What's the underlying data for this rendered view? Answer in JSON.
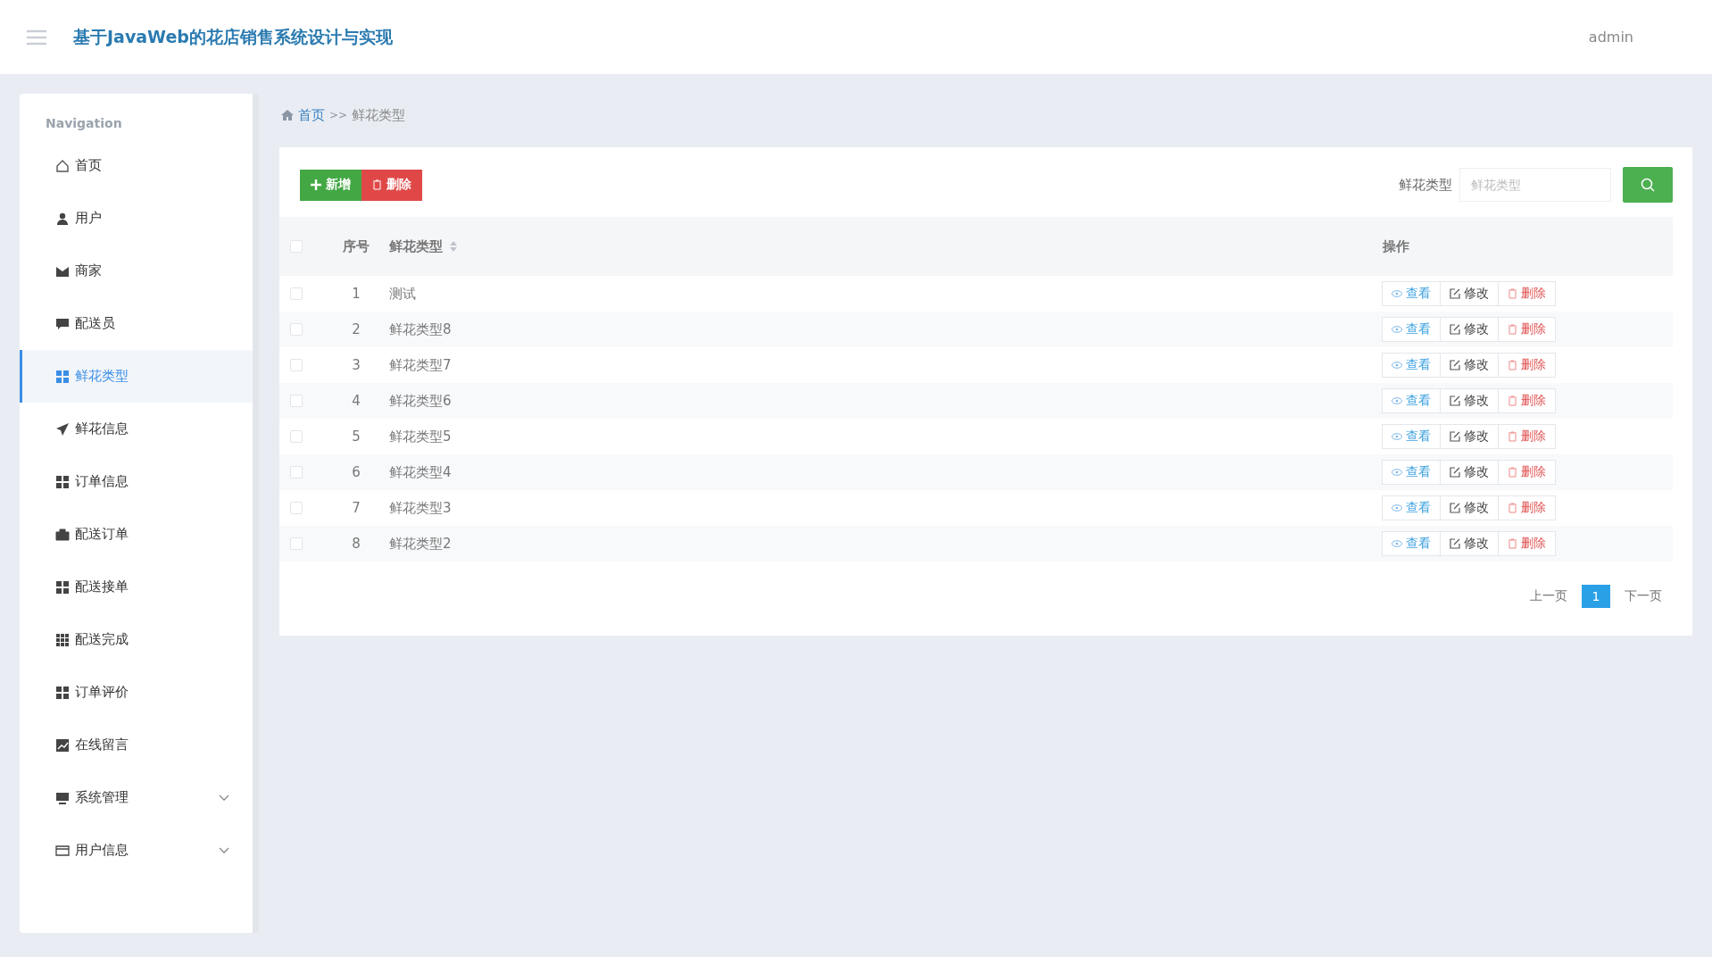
{
  "header": {
    "title": "基于JavaWeb的花店销售系统设计与实现",
    "user": "admin"
  },
  "sidebar": {
    "heading": "Navigation",
    "items": [
      {
        "label": "首页",
        "kind": "link",
        "selected": false
      },
      {
        "label": "用户",
        "kind": "link",
        "selected": false
      },
      {
        "label": "商家",
        "kind": "link",
        "selected": false
      },
      {
        "label": "配送员",
        "kind": "link",
        "selected": false
      },
      {
        "label": "鲜花类型",
        "kind": "link",
        "selected": true
      },
      {
        "label": "鲜花信息",
        "kind": "link",
        "selected": false
      },
      {
        "label": "订单信息",
        "kind": "link",
        "selected": false
      },
      {
        "label": "配送订单",
        "kind": "link",
        "selected": false
      },
      {
        "label": "配送接单",
        "kind": "link",
        "selected": false
      },
      {
        "label": "配送完成",
        "kind": "link",
        "selected": false
      },
      {
        "label": "订单评价",
        "kind": "link",
        "selected": false
      },
      {
        "label": "在线留言",
        "kind": "link",
        "selected": false
      },
      {
        "label": "系统管理",
        "kind": "group",
        "expanded": false,
        "selected": false
      },
      {
        "label": "用户信息",
        "kind": "group",
        "expanded": false,
        "selected": false
      }
    ]
  },
  "breadcrumb": {
    "home": "首页",
    "separator": ">>",
    "current": "鲜花类型"
  },
  "toolbar": {
    "add": "新增",
    "delete": "删除",
    "search_label": "鲜花类型",
    "search_placeholder": "鲜花类型"
  },
  "table": {
    "select_all_checked": false,
    "columns": [
      "序号",
      "鲜花类型",
      "操作"
    ],
    "rows": [
      {
        "index": "1",
        "name": "测试",
        "checked": false,
        "actions": [
          "查看",
          "修改",
          "删除"
        ]
      },
      {
        "index": "2",
        "name": "鲜花类型8",
        "checked": false,
        "actions": [
          "查看",
          "修改",
          "删除"
        ]
      },
      {
        "index": "3",
        "name": "鲜花类型7",
        "checked": false,
        "actions": [
          "查看",
          "修改",
          "删除"
        ]
      },
      {
        "index": "4",
        "name": "鲜花类型6",
        "checked": false,
        "actions": [
          "查看",
          "修改",
          "删除"
        ]
      },
      {
        "index": "5",
        "name": "鲜花类型5",
        "checked": false,
        "actions": [
          "查看",
          "修改",
          "删除"
        ]
      },
      {
        "index": "6",
        "name": "鲜花类型4",
        "checked": false,
        "actions": [
          "查看",
          "修改",
          "删除"
        ]
      },
      {
        "index": "7",
        "name": "鲜花类型3",
        "checked": false,
        "actions": [
          "查看",
          "修改",
          "删除"
        ]
      },
      {
        "index": "8",
        "name": "鲜花类型2",
        "checked": false,
        "actions": [
          "查看",
          "修改",
          "删除"
        ]
      }
    ]
  },
  "pagination": {
    "prev": "上一页",
    "pages": [
      {
        "label": "1",
        "selected": true
      }
    ],
    "next": "下一页"
  }
}
